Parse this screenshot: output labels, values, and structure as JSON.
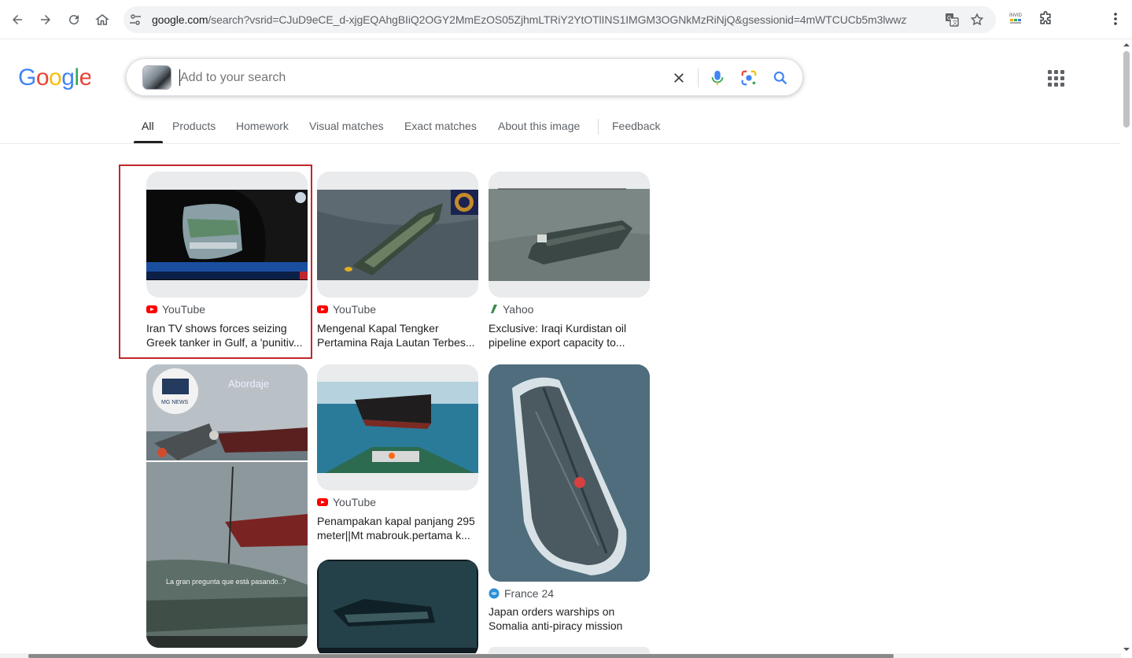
{
  "browser": {
    "url_host": "google.com",
    "url_rest": "/search?vsrid=CJuD9eCE_d-xjgEQAhgBIiQ2OGY2MmEzOS05ZjhmLTRiY2YtOTlINS1IMGM3OGNkMzRiNjQ&gsessionid=4mWTCUCb5m3lwwzv1enrrC...",
    "ext_label": "INVID"
  },
  "search": {
    "placeholder": "Add to your search"
  },
  "tabs": [
    "All",
    "Products",
    "Homework",
    "Visual matches",
    "Exact matches",
    "About this image",
    "Feedback"
  ],
  "results": [
    {
      "source": "YouTube",
      "title": "Iran TV shows forces seizing Greek tanker in Gulf, a 'punitiv..."
    },
    {
      "source": "YouTube",
      "title": "Mengenal Kapal Tengker Pertamina Raja Lautan Terbes..."
    },
    {
      "source": "Yahoo",
      "title": "Exclusive: Iraqi Kurdistan oil pipeline export capacity to..."
    },
    {
      "source": "",
      "title": "",
      "watermark": "Abordaje",
      "overlay": "La gran pregunta que está pasando..?",
      "logo": "MG NEWS"
    },
    {
      "source": "YouTube",
      "title": "Penampakan kapal panjang 295 meter||Mt mabrouk.pertama k..."
    },
    {
      "source": "France 24",
      "title": "Japan orders warships on Somalia anti-piracy mission"
    }
  ],
  "colors": {
    "youtube": "#ff0000",
    "highlight": "#c0272d",
    "link": "#1a0dab"
  }
}
